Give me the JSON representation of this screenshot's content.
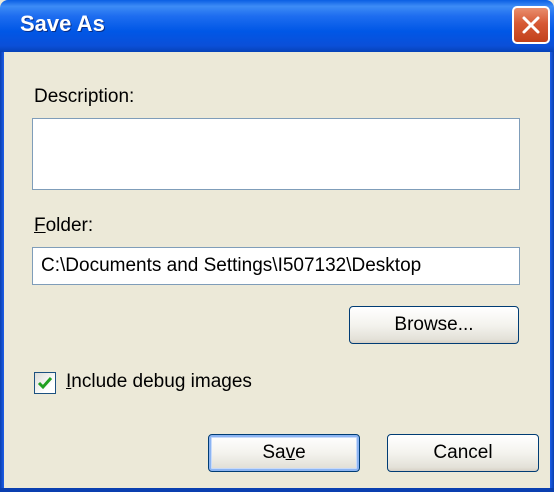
{
  "window": {
    "title": "Save As",
    "close_icon": "close-icon"
  },
  "description": {
    "label": "Description:",
    "value": ""
  },
  "folder": {
    "label_mnemonic": "F",
    "label_rest": "older:",
    "value": "C:\\Documents and Settings\\I507132\\Desktop"
  },
  "browse_button": {
    "label": "Browse..."
  },
  "debug_images": {
    "label_mnemonic": "I",
    "label_rest": "nclude debug images",
    "checked": true
  },
  "save_button": {
    "label_pre": "Sa",
    "label_mnemonic": "v",
    "label_post": "e"
  },
  "cancel_button": {
    "label": "Cancel"
  },
  "colors": {
    "titlebar": "#0057e6",
    "dialog_bg": "#ece9d8",
    "close_red": "#d75a35",
    "check_green": "#21a121"
  }
}
